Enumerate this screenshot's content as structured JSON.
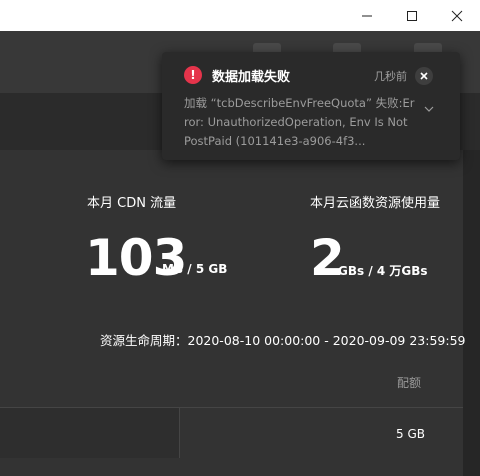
{
  "window": {
    "minimize_icon": "minimize-icon",
    "maximize_icon": "maximize-icon",
    "close_icon": "close-icon"
  },
  "toast": {
    "title": "数据加载失败",
    "time": "几秒前",
    "message": "加载 “tcbDescribeEnvFreeQuota” 失败:Error: UnauthorizedOperation, Env Is Not PostPaid (101141e3-a906-4f3...",
    "error_icon_glyph": "!",
    "error_color": "#e5344b"
  },
  "stats": {
    "cdn": {
      "label": "本月 CDN 流量",
      "value": "103",
      "unit": "MB / 5 GB"
    },
    "scf": {
      "label": "本月云函数资源使用量",
      "value": "2",
      "unit": "GBs / 4 万GBs"
    }
  },
  "lifecycle": {
    "text": "资源生命周期：2020-08-10 00:00:00 - 2020-09-09 23:59:59"
  },
  "table": {
    "quota_header": "配额",
    "rows": [
      {
        "quota": "5 GB"
      }
    ]
  }
}
